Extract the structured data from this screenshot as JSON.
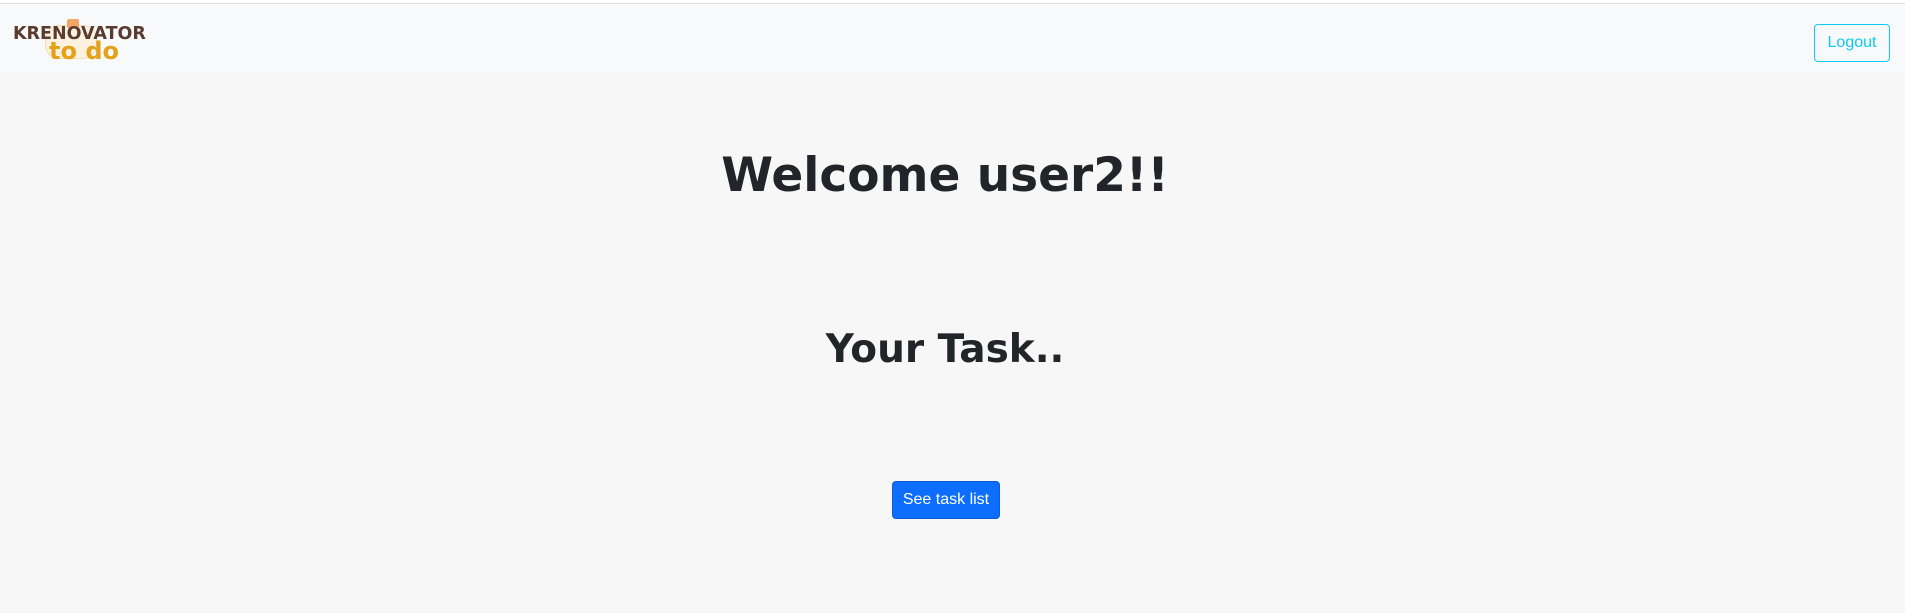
{
  "navbar": {
    "logo": {
      "title": "KRENOVATOR",
      "subtitle": "to do",
      "colors": {
        "title": "#5a3b30",
        "subtitle": "#e6a11a",
        "blob": "#fdf1df"
      }
    },
    "logout_label": "Logout"
  },
  "main": {
    "welcome_text": "Welcome user2!!",
    "task_heading": "Your Task..",
    "see_task_list_label": "See task list"
  },
  "colors": {
    "primary": "#0d6efd",
    "info": "#0dcaf0",
    "background": "#f7f7f7",
    "navbar_bg": "#f8f9fa",
    "text": "#212529"
  }
}
